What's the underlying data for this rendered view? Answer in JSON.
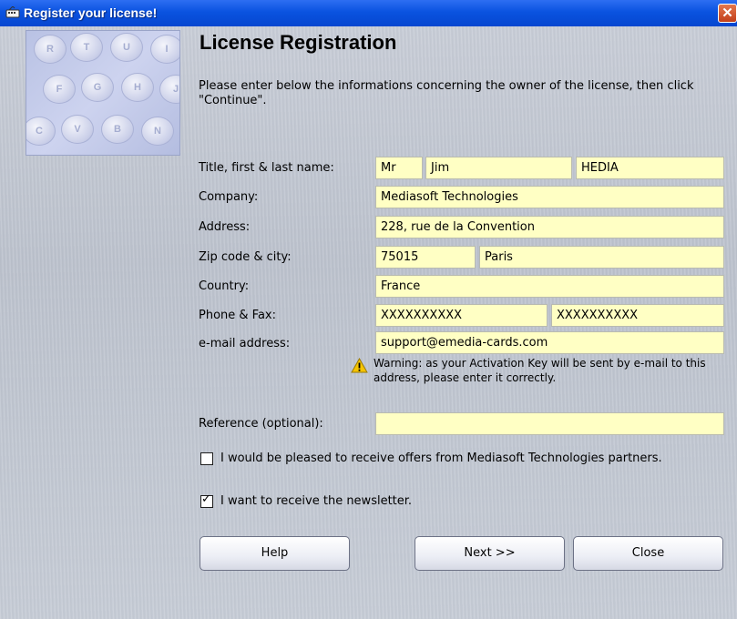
{
  "window": {
    "title": "Register your license!",
    "close_glyph": "✕"
  },
  "banner": {
    "keys": [
      "R",
      "T",
      "U",
      "I",
      "F",
      "G",
      "H",
      "J",
      "C",
      "V",
      "B",
      "N"
    ]
  },
  "heading": "License Registration",
  "intro": "Please enter below the informations concerning the owner of the license, then click \"Continue\".",
  "form": {
    "name": {
      "label": "Title, first & last name:",
      "title": "Mr",
      "first": "Jim",
      "last": "HEDIA"
    },
    "company": {
      "label": "Company:",
      "value": "Mediasoft Technologies"
    },
    "address": {
      "label": "Address:",
      "value": "228, rue de la Convention"
    },
    "zipcity": {
      "label": "Zip code & city:",
      "zip": "75015",
      "city": "Paris"
    },
    "country": {
      "label": "Country:",
      "value": "France"
    },
    "phonefax": {
      "label": "Phone & Fax:",
      "phone": "XXXXXXXXXX",
      "fax": "XXXXXXXXXX"
    },
    "email": {
      "label": "e-mail address:",
      "value": "support@emedia-cards.com"
    },
    "warning": "Warning: as your Activation Key will be sent by e-mail to this address, please enter it correctly.",
    "reference": {
      "label": "Reference (optional):",
      "value": ""
    }
  },
  "checkboxes": {
    "offers": {
      "label": "I would be pleased to receive offers from Mediasoft Technologies partners.",
      "checked": false
    },
    "newsletter": {
      "label": "I want to receive the newsletter.",
      "checked": true
    }
  },
  "buttons": {
    "help": "Help",
    "next": "Next >>",
    "close": "Close"
  },
  "colors": {
    "titlebar": "#0a53e0",
    "field_bg": "#ffffc4",
    "warning": "#f5c400"
  }
}
